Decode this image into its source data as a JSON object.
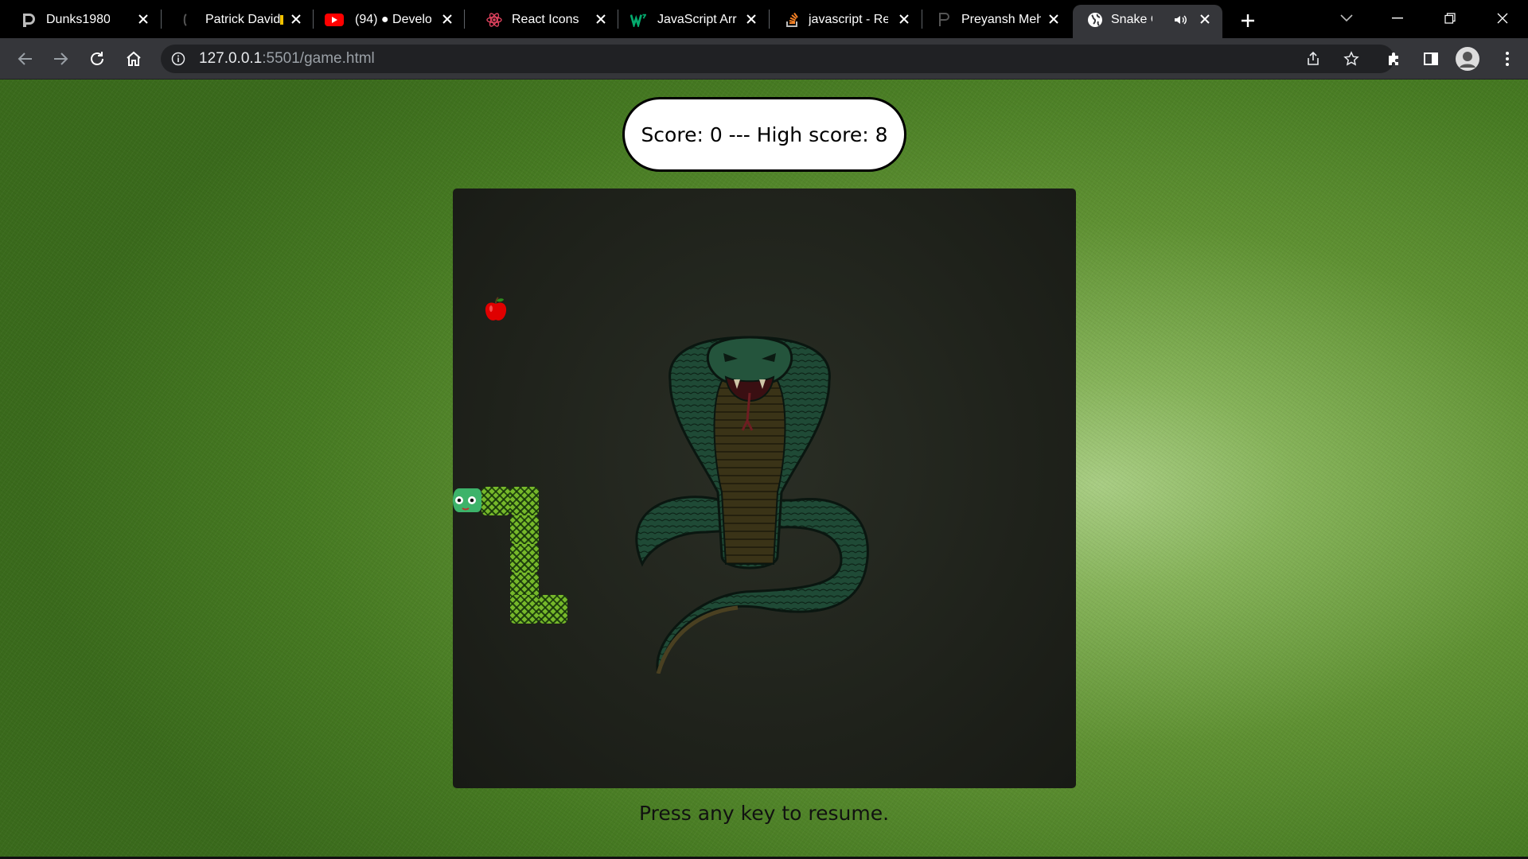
{
  "browser": {
    "tabs": [
      {
        "title": "Dunks1980",
        "icon": "dunks-icon"
      },
      {
        "title": "Patrick David",
        "icon": "github-icon"
      },
      {
        "title": "(94) ● Develo",
        "icon": "youtube-icon"
      },
      {
        "title": "React Icons",
        "icon": "react-icon"
      },
      {
        "title": "JavaScript Arra",
        "icon": "w3schools-icon"
      },
      {
        "title": "javascript - Re",
        "icon": "stackoverflow-icon"
      },
      {
        "title": "Preyansh Meh",
        "icon": "profile-icon"
      },
      {
        "title": "Snake Ga",
        "icon": "globe-icon",
        "active": true,
        "audio": true
      }
    ],
    "address": {
      "host": "127.0.0.1",
      "path": ":5501/game.html"
    }
  },
  "game": {
    "score_text": "Score: 0 --- High score: 8",
    "score": 0,
    "high_score": 8,
    "hint": "Press any key to resume."
  },
  "colors": {
    "board": "#1f221b",
    "snake": "#76b82a",
    "apple": "#e00000",
    "page_bg": "#5f9133"
  }
}
